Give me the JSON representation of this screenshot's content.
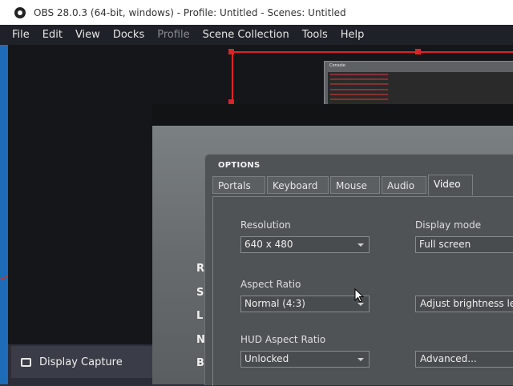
{
  "window": {
    "title": "OBS 28.0.3 (64-bit, windows) - Profile: Untitled - Scenes: Untitled"
  },
  "menu": {
    "items": [
      "File",
      "Edit",
      "View",
      "Docks",
      "Profile",
      "Scene Collection",
      "Tools",
      "Help"
    ]
  },
  "sources": {
    "item_label": "Display Capture"
  },
  "console": {
    "title": "Console"
  },
  "game": {
    "sidebar_letters": [
      "R",
      "S",
      "L",
      "N",
      "B"
    ]
  },
  "options_dialog": {
    "title": "OPTIONS",
    "tabs": [
      "Portals",
      "Keyboard",
      "Mouse",
      "Audio",
      "Video"
    ],
    "active_tab": "Video",
    "resolution_label": "Resolution",
    "resolution_value": "640 x 480",
    "display_mode_label": "Display mode",
    "display_mode_value": "Full screen",
    "aspect_ratio_label": "Aspect Ratio",
    "aspect_ratio_value": "Normal (4:3)",
    "adjust_brightness_label": "Adjust brightness lev",
    "hud_aspect_label": "HUD Aspect Ratio",
    "hud_aspect_value": "Unlocked",
    "advanced_label": "Advanced..."
  },
  "colors": {
    "selection_red": "#e0202a",
    "menubar_bg": "#1f2128",
    "dialog_bg": "#4f5355"
  }
}
